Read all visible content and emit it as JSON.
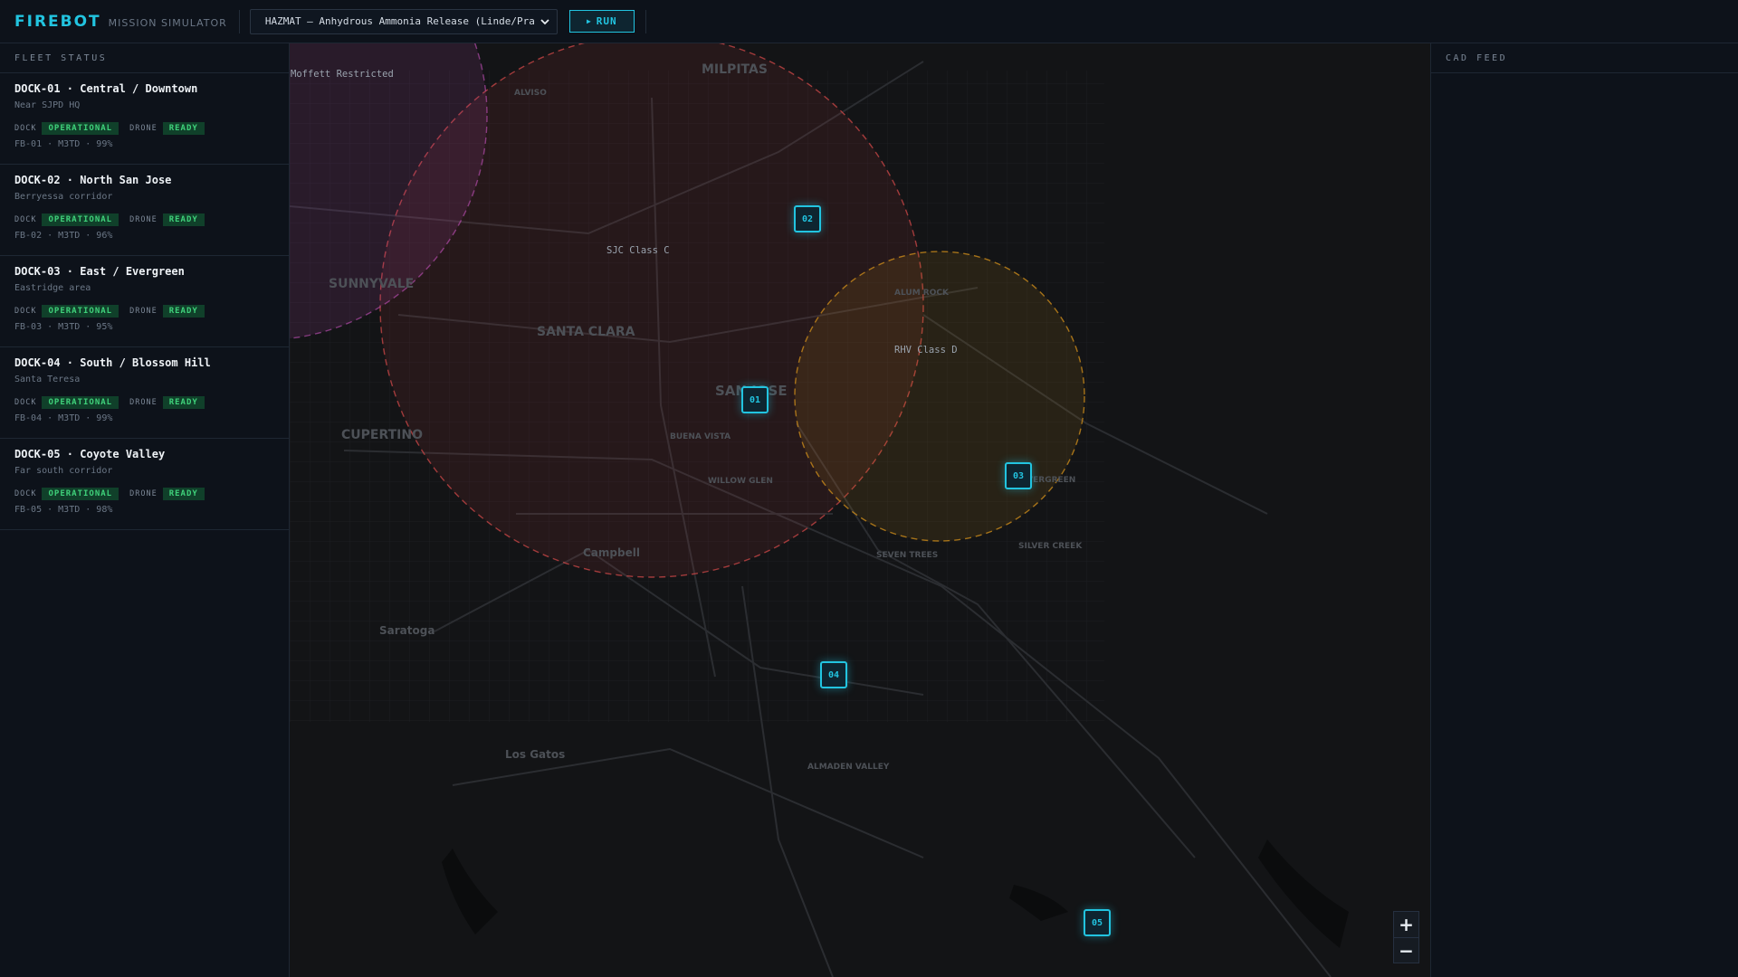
{
  "header": {
    "brand": "FIREBOT",
    "subtitle": "MISSION SIMULATOR",
    "scenario": "HAZMAT — Anhydrous Ammonia Release (Linde/Pra",
    "run_label": "RUN",
    "run_icon": "play-icon"
  },
  "fleet": {
    "title": "FLEET STATUS",
    "dock_label": "DOCK",
    "drone_label": "DRONE",
    "docks": [
      {
        "name": "DOCK-01 · Central / Downtown",
        "location": "Near SJPD HQ",
        "dock_status": "OPERATIONAL",
        "drone_status": "READY",
        "meta": "FB-01 · M3TD · 99%"
      },
      {
        "name": "DOCK-02 · North San Jose",
        "location": "Berryessa corridor",
        "dock_status": "OPERATIONAL",
        "drone_status": "READY",
        "meta": "FB-02 · M3TD · 96%"
      },
      {
        "name": "DOCK-03 · East / Evergreen",
        "location": "Eastridge area",
        "dock_status": "OPERATIONAL",
        "drone_status": "READY",
        "meta": "FB-03 · M3TD · 95%"
      },
      {
        "name": "DOCK-04 · South / Blossom Hill",
        "location": "Santa Teresa",
        "dock_status": "OPERATIONAL",
        "drone_status": "READY",
        "meta": "FB-04 · M3TD · 99%"
      },
      {
        "name": "DOCK-05 · Coyote Valley",
        "location": "Far south corridor",
        "dock_status": "OPERATIONAL",
        "drone_status": "READY",
        "meta": "FB-05 · M3TD · 98%"
      }
    ]
  },
  "cad": {
    "title": "CAD FEED"
  },
  "map": {
    "airspace": [
      {
        "label": "Moffett Restricted",
        "color": "#b04aa8"
      },
      {
        "label": "SJC Class C",
        "color": "#d04848"
      },
      {
        "label": "RHV Class D",
        "color": "#c98a1a"
      }
    ],
    "places": [
      "MILPITAS",
      "ALVISO",
      "SUNNYVALE",
      "SANTA CLARA",
      "SAN JOSE",
      "CUPERTINO",
      "BUENA VISTA",
      "WILLOW GLEN",
      "Campbell",
      "Saratoga",
      "Los Gatos",
      "ALUM ROCK",
      "EVERGREEN",
      "SEVEN TREES",
      "SILVER CREEK",
      "ALMADEN VALLEY"
    ],
    "markers": [
      "01",
      "02",
      "03",
      "04",
      "05"
    ],
    "zoom_in": "+",
    "zoom_out": "−"
  }
}
